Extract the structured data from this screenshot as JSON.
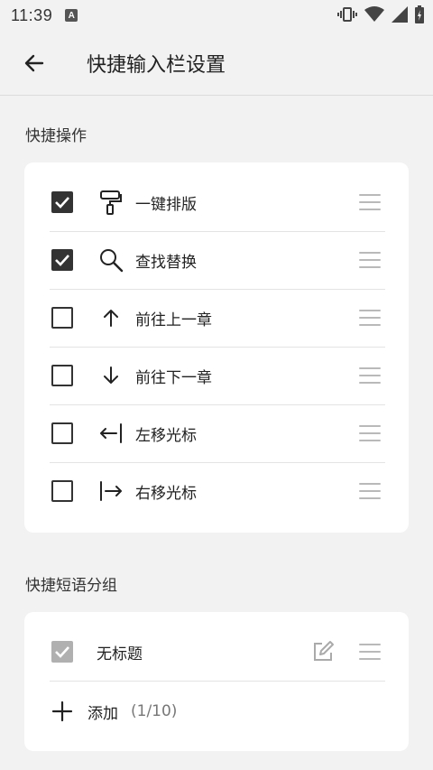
{
  "status_bar": {
    "time": "11:39",
    "notif": "A"
  },
  "appbar": {
    "title": "快捷输入栏设置"
  },
  "quick_actions": {
    "section_title": "快捷操作",
    "items": [
      {
        "label": "一键排版",
        "checked": true,
        "icon": "paint-roller-icon"
      },
      {
        "label": "查找替换",
        "checked": true,
        "icon": "search-icon"
      },
      {
        "label": "前往上一章",
        "checked": false,
        "icon": "arrow-up-icon"
      },
      {
        "label": "前往下一章",
        "checked": false,
        "icon": "arrow-down-icon"
      },
      {
        "label": "左移光标",
        "checked": false,
        "icon": "cursor-left-icon"
      },
      {
        "label": "右移光标",
        "checked": false,
        "icon": "cursor-right-icon"
      }
    ]
  },
  "phrase_groups": {
    "section_title": "快捷短语分组",
    "items": [
      {
        "label": "无标题",
        "checked": true,
        "disabled": true
      }
    ],
    "add_label": "添加",
    "add_count": "(1/10)"
  },
  "colors": {
    "background": "#f3f2f3",
    "card": "#ffffff",
    "checkbox": "#333333",
    "checkbox_disabled": "#b0b0b0",
    "handle": "#b9b9b9"
  }
}
